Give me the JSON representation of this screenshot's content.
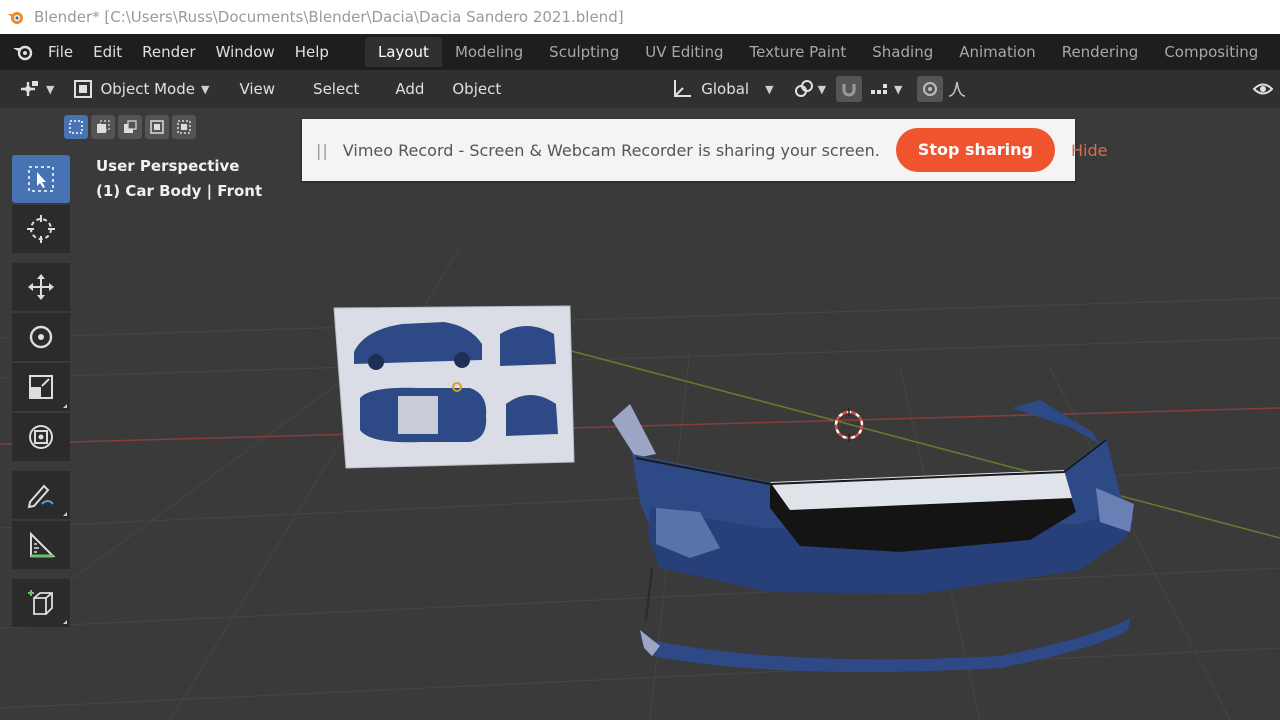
{
  "window": {
    "title": "Blender* [C:\\Users\\Russ\\Documents\\Blender\\Dacia\\Dacia Sandero 2021.blend]"
  },
  "menu": [
    "File",
    "Edit",
    "Render",
    "Window",
    "Help"
  ],
  "workspace_tabs": [
    "Layout",
    "Modeling",
    "Sculpting",
    "UV Editing",
    "Texture Paint",
    "Shading",
    "Animation",
    "Rendering",
    "Compositing"
  ],
  "active_tab": "Layout",
  "header": {
    "mode": "Object Mode",
    "menus": [
      "View",
      "Select",
      "Add",
      "Object"
    ],
    "transform_orientation": "Global"
  },
  "viewport": {
    "perspective": "User Perspective",
    "object_info": "(1) Car Body | Front"
  },
  "notification": {
    "handle": "||",
    "message": "Vimeo Record - Screen & Webcam Recorder is sharing your screen.",
    "stop_label": "Stop sharing",
    "hide_label": "Hide"
  },
  "tools": [
    "select-box",
    "cursor",
    "move",
    "rotate",
    "scale",
    "transform",
    "annotate",
    "measure",
    "add-cube"
  ],
  "colors": {
    "accent": "#4772b3",
    "stop_button": "#f0542e",
    "car_blue": "#2e4a86"
  }
}
